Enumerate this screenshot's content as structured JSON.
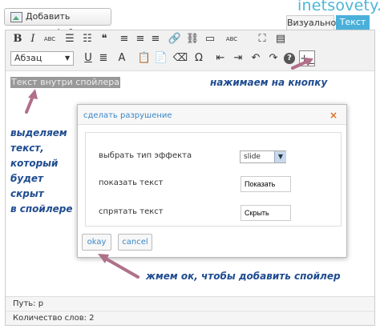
{
  "add_media_label": "Добавить медиафайл",
  "logo_text": "inetsovety.ru",
  "tabs": {
    "visual": "Визуально",
    "text": "Текст"
  },
  "toolbar": {
    "row1": [
      {
        "icon": "bold-icon",
        "glyph": "B"
      },
      {
        "icon": "italic-icon",
        "glyph": "I"
      },
      {
        "icon": "strikethrough-icon",
        "glyph": "ABC"
      },
      {
        "icon": "bullet-list-icon",
        "glyph": "☰"
      },
      {
        "icon": "numbered-list-icon",
        "glyph": "☷"
      },
      {
        "icon": "blockquote-icon",
        "glyph": "❝"
      },
      {
        "icon": "align-left-icon",
        "glyph": "≡"
      },
      {
        "icon": "align-center-icon",
        "glyph": "≡"
      },
      {
        "icon": "align-right-icon",
        "glyph": "≡"
      },
      {
        "icon": "link-icon",
        "glyph": "🔗"
      },
      {
        "icon": "unlink-icon",
        "glyph": "⛓"
      },
      {
        "icon": "read-more-icon",
        "glyph": "▭"
      },
      {
        "icon": "spellcheck-icon",
        "glyph": "ABC"
      },
      {
        "icon": "fullscreen-icon",
        "glyph": "⛶"
      },
      {
        "icon": "kitchen-sink-icon",
        "glyph": "▤"
      }
    ],
    "row2": [
      {
        "icon": "underline-icon",
        "glyph": "U"
      },
      {
        "icon": "justify-icon",
        "glyph": "≣"
      },
      {
        "icon": "text-color-icon",
        "glyph": "A"
      },
      {
        "icon": "paste-text-icon",
        "glyph": "📋"
      },
      {
        "icon": "paste-word-icon",
        "glyph": "📄"
      },
      {
        "icon": "clear-formatting-icon",
        "glyph": "⌫"
      },
      {
        "icon": "special-character-icon",
        "glyph": "Ω"
      },
      {
        "icon": "outdent-icon",
        "glyph": "⇤"
      },
      {
        "icon": "indent-icon",
        "glyph": "⇥"
      },
      {
        "icon": "undo-icon",
        "glyph": "↶"
      },
      {
        "icon": "redo-icon",
        "glyph": "↷"
      },
      {
        "icon": "help-icon",
        "glyph": "?"
      }
    ],
    "format_value": "Абзац",
    "spoiler_button_glyph": "+_"
  },
  "editor": {
    "selected_text": "Текст внутри спойлера"
  },
  "annotations": {
    "press_button": "нажимаем на кнопку",
    "select_text_lines": [
      "выделяем",
      "текст,",
      "который",
      "будет",
      "скрыт",
      "в спойлере"
    ],
    "press_ok": "жмем ок, чтобы добавить спойлер"
  },
  "dialog": {
    "title": "сделать разрушение",
    "close_glyph": "×",
    "effect_label": "выбрать тип эффекта",
    "effect_value": "slide",
    "show_label": "показать текст",
    "show_value": "Показать",
    "hide_label": "спрятать текст",
    "hide_value": "Скрыть",
    "ok_label": "okay",
    "cancel_label": "cancel"
  },
  "status": {
    "path": "Путь: p",
    "word_count": "Количество слов: 2"
  },
  "colors": {
    "accent": "#4ab0da",
    "annotation": "#1e4b8f",
    "arrow": "#b0708a"
  }
}
